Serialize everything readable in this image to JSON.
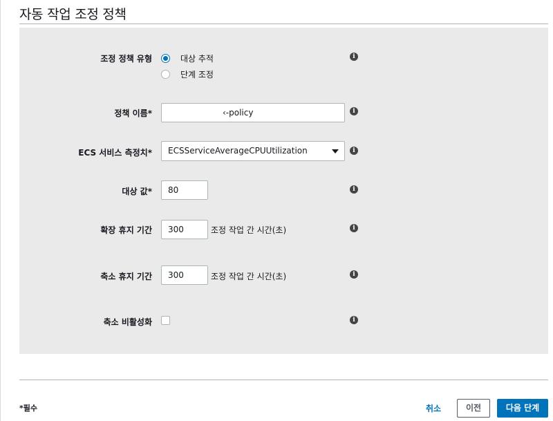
{
  "page": {
    "title": "자동 작업 조정 정책"
  },
  "form": {
    "policy_type": {
      "label": "조정 정책 유형",
      "options": [
        {
          "label": "대상 추적",
          "selected": true
        },
        {
          "label": "단계 조정",
          "selected": false
        }
      ]
    },
    "policy_name": {
      "label": "정책 이름*",
      "value": "‹-policy"
    },
    "ecs_metric": {
      "label": "ECS 서비스 측정치*",
      "value": "ECSServiceAverageCPUUtilization"
    },
    "target_value": {
      "label": "대상 값*",
      "value": "80"
    },
    "scale_out_cooldown": {
      "label": "확장 휴지 기간",
      "value": "300",
      "unit": "조정 작업 간 시간(초)"
    },
    "scale_in_cooldown": {
      "label": "축소 휴지 기간",
      "value": "300",
      "unit": "조정 작업 간 시간(초)"
    },
    "disable_scale_in": {
      "label": "축소 비활성화",
      "checked": false
    },
    "info_icon_glyph": "i"
  },
  "footer": {
    "required_note": "*필수",
    "cancel_label": "취소",
    "previous_label": "이전",
    "next_label": "다음 단계"
  },
  "colors": {
    "accent": "#0073bb",
    "panel": "#eaeaea"
  },
  "icons": {
    "info": "info-icon",
    "select_caret": "caret-down-icon"
  }
}
